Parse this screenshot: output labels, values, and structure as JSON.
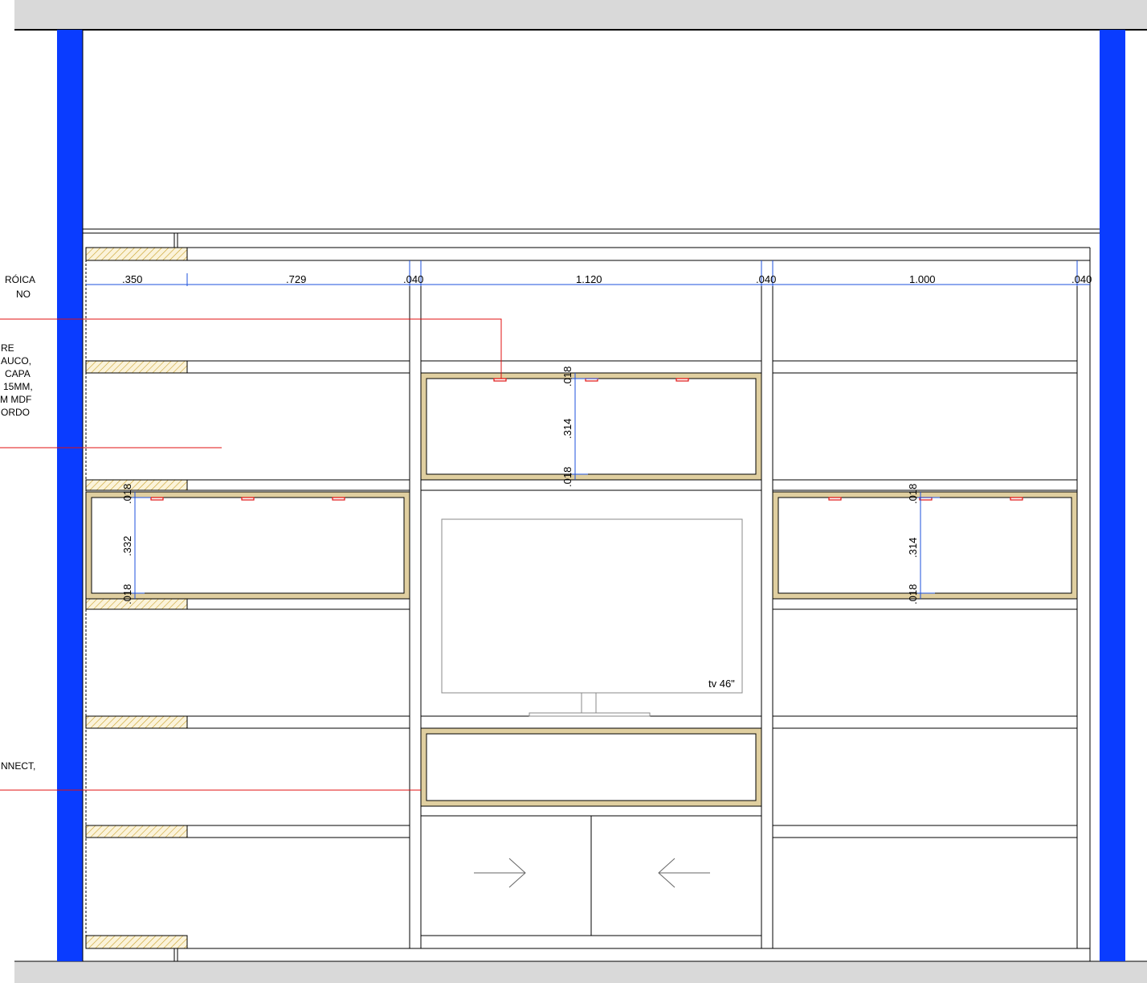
{
  "colors": {
    "wall": "#0a3cff",
    "line": "#000000",
    "dim": "#1e50dc",
    "leader": "#e01010",
    "veneer": "#e0cfa0",
    "hatch": "#c9a22a",
    "band": "#d9d9d9"
  },
  "dimensions": {
    "d350": ".350",
    "d729": ".729",
    "d040a": ".040",
    "d1120": "1.120",
    "d040b": ".040",
    "d1000": "1.000",
    "d040c": ".040"
  },
  "vertical_dims": {
    "top_018a": ".018",
    "top_314": ".314",
    "top_018b": ".018",
    "left_018a": ".018",
    "left_332": ".332",
    "left_018b": ".018",
    "right_018a": ".018",
    "right_314": ".314",
    "right_018b": ".018"
  },
  "tv_label": "tv 46\"",
  "notes": {
    "note1_line1": "RÓICA",
    "note1_line2": "NO",
    "note2_line1": "RE",
    "note2_line2": "AUCO,",
    "note2_line3": "CAPA",
    "note2_line4": "15MM,",
    "note2_line5": "M MDF",
    "note2_line6": "ORDO",
    "note3_line1": "NNECT,"
  }
}
